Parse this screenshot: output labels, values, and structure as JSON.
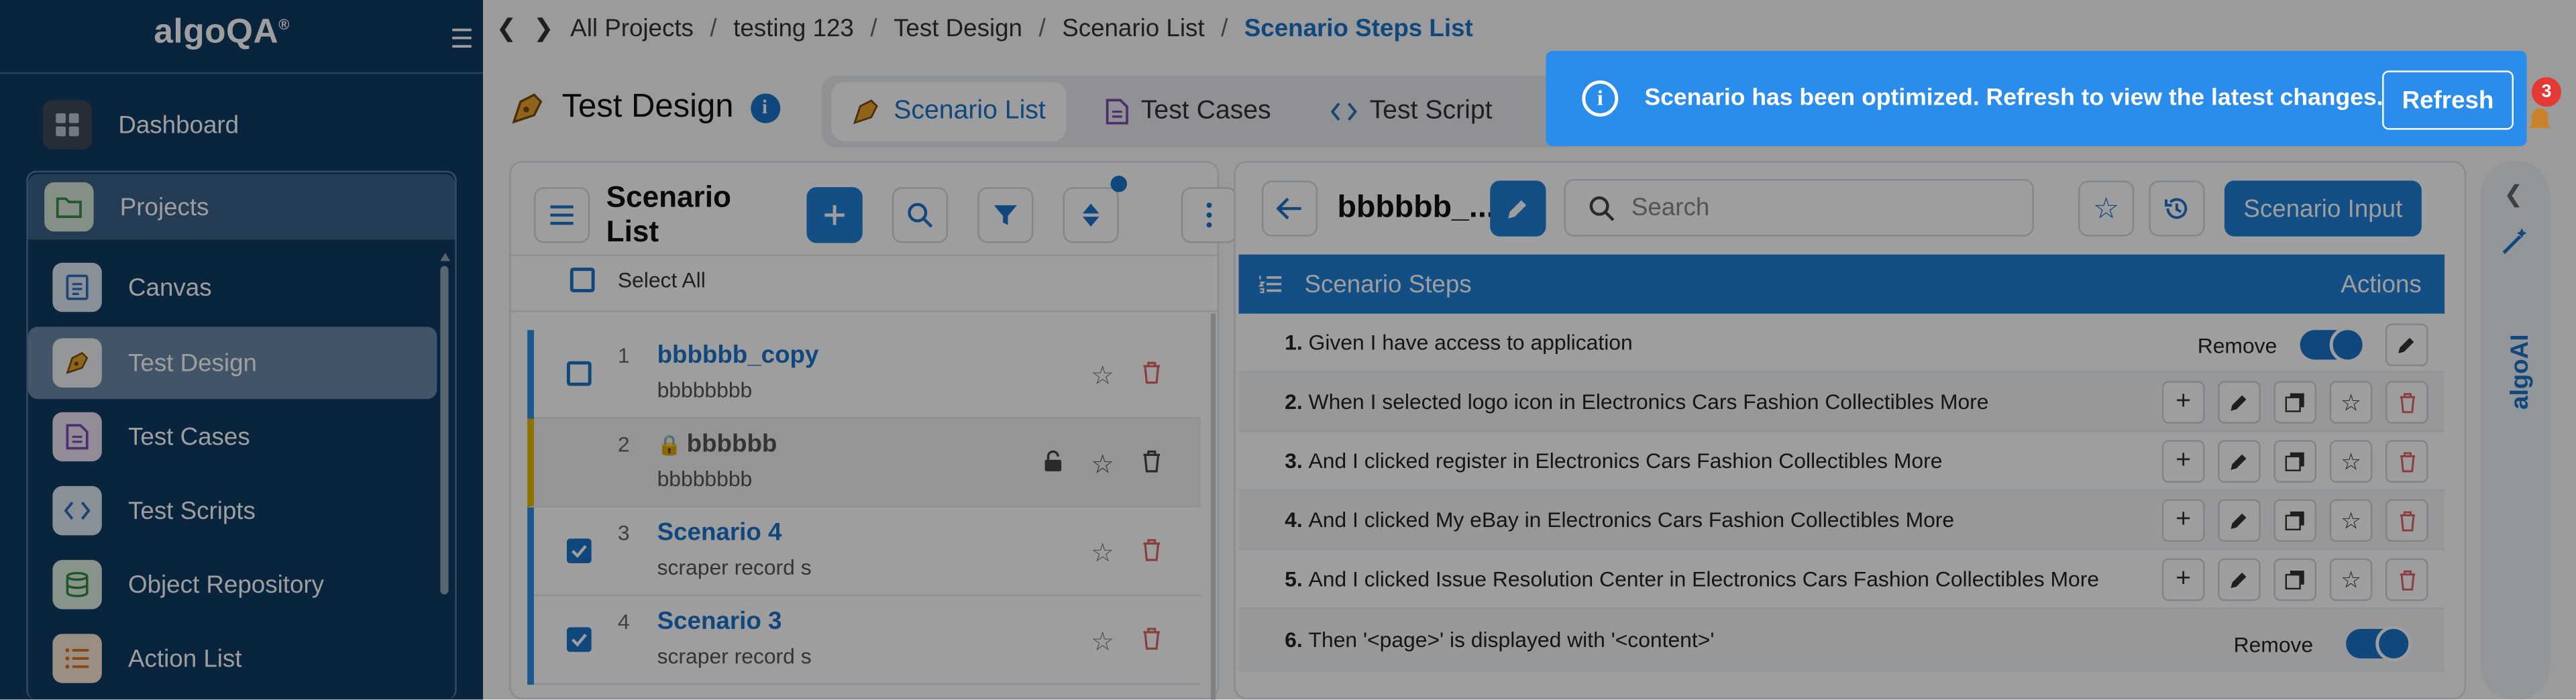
{
  "sidebar": {
    "logo": "algoQA",
    "logo_mark": "®",
    "items": [
      {
        "label": "Dashboard",
        "icon": "grid-icon"
      },
      {
        "label": "Projects",
        "icon": "folder-icon"
      },
      {
        "label": "Canvas",
        "icon": "canvas-icon"
      },
      {
        "label": "Test Design",
        "icon": "pen-nib-icon"
      },
      {
        "label": "Test Cases",
        "icon": "document-icon"
      },
      {
        "label": "Test Scripts",
        "icon": "code-icon"
      },
      {
        "label": "Object Repository",
        "icon": "database-icon"
      },
      {
        "label": "Action List",
        "icon": "list-icon"
      }
    ]
  },
  "breadcrumb": [
    "All Projects",
    "testing 123",
    "Test Design",
    "Scenario List",
    "Scenario Steps List"
  ],
  "page_title": "Test Design",
  "tabs": [
    "Scenario List",
    "Test Cases",
    "Test Script"
  ],
  "scenario_list": {
    "title": "Scenario List",
    "select_all": "Select All",
    "rows": [
      {
        "num": "1",
        "name": "bbbbbb_copy",
        "sub": "bbbbbbbb",
        "checked": false,
        "locked": false
      },
      {
        "num": "2",
        "name": "bbbbbb",
        "sub": "bbbbbbbb",
        "checked": false,
        "locked": true
      },
      {
        "num": "3",
        "name": "Scenario 4",
        "sub": "scraper record s",
        "checked": true,
        "locked": false
      },
      {
        "num": "4",
        "name": "Scenario 3",
        "sub": "scraper record s",
        "checked": true,
        "locked": false
      }
    ]
  },
  "steps_panel": {
    "scenario_name": "bbbbbb_...",
    "search_placeholder": "Search",
    "scenario_input_label": "Scenario Input",
    "header_label": "Scenario Steps",
    "actions_label": "Actions",
    "remove_label": "Remove",
    "steps": [
      {
        "num": "1.",
        "text": "Given I have access to application"
      },
      {
        "num": "2.",
        "text": "When I selected logo icon in Electronics Cars Fashion Collectibles More"
      },
      {
        "num": "3.",
        "text": "And I clicked register in Electronics Cars Fashion Collectibles More"
      },
      {
        "num": "4.",
        "text": "And I clicked My eBay in Electronics Cars Fashion Collectibles More"
      },
      {
        "num": "5.",
        "text": "And I clicked Issue Resolution Center in Electronics Cars Fashion Collectibles More"
      },
      {
        "num": "6.",
        "text": "Then '<page>' is displayed with '<content>'"
      }
    ]
  },
  "algoai_label": "algoAI",
  "notification_count": "3",
  "toast": {
    "message": "Scenario has been optimized. Refresh to view the latest changes.",
    "button": "Refresh"
  },
  "colors": {
    "sidebar": "#0f3a63",
    "accent": "#1a73c9",
    "toast": "#2a8ceb",
    "danger": "#e53935"
  }
}
